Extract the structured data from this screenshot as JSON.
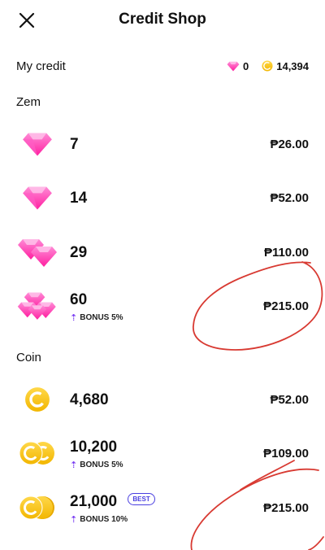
{
  "header": {
    "title": "Credit Shop"
  },
  "credit": {
    "label": "My credit",
    "zem": "0",
    "coins": "14,394"
  },
  "zem_section": {
    "label": "Zem",
    "items": [
      {
        "amount": "7",
        "price": "₱26.00"
      },
      {
        "amount": "14",
        "price": "₱52.00"
      },
      {
        "amount": "29",
        "price": "₱110.00"
      },
      {
        "amount": "60",
        "price": "₱215.00",
        "bonus": "BONUS 5%"
      }
    ]
  },
  "coin_section": {
    "label": "Coin",
    "items": [
      {
        "amount": "4,680",
        "price": "₱52.00"
      },
      {
        "amount": "10,200",
        "price": "₱109.00",
        "bonus": "BONUS 5%"
      },
      {
        "amount": "21,000",
        "price": "₱215.00",
        "bonus": "BONUS 10%",
        "badge": "BEST"
      }
    ]
  },
  "colors": {
    "gem": "#ff3fb4",
    "coin": "#f5c400",
    "bonus_arrow": "#7b3ff2",
    "annotation": "#d83a32"
  }
}
